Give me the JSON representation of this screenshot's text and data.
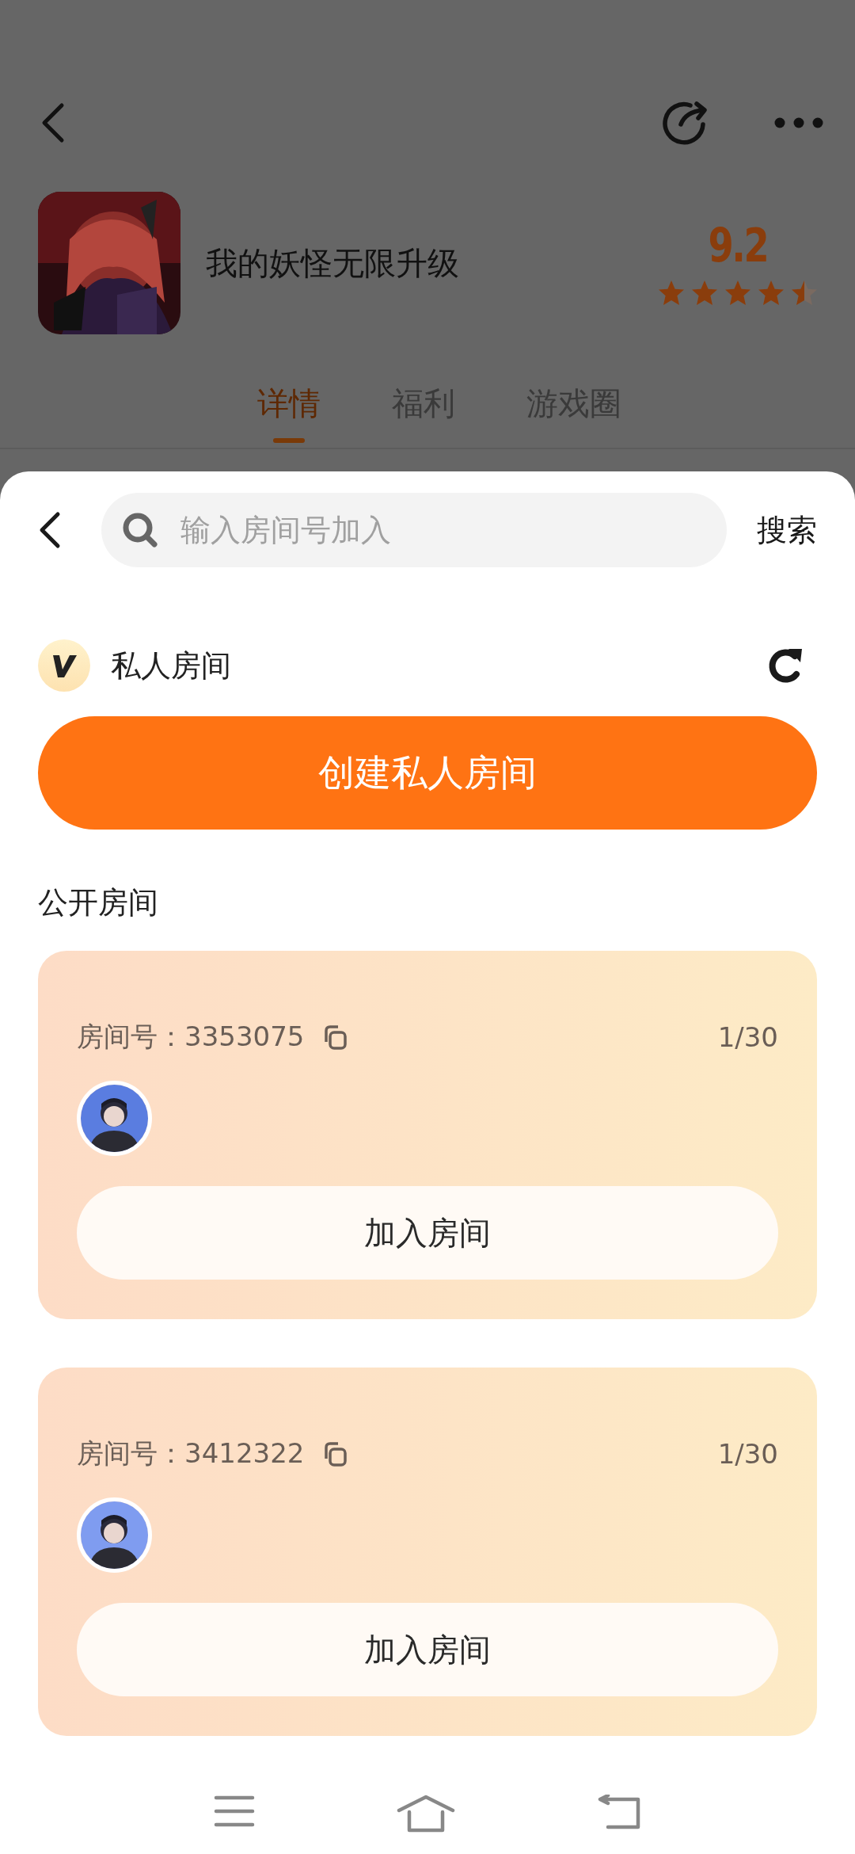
{
  "header": {
    "app_title": "我的妖怪无限升级",
    "score": "9.2",
    "stars": 4.5
  },
  "tabs": [
    {
      "label": "详情",
      "selected": true
    },
    {
      "label": "福利",
      "selected": false
    },
    {
      "label": "游戏圈",
      "selected": false
    }
  ],
  "sheet": {
    "search": {
      "placeholder": "输入房间号加入",
      "button": "搜索"
    },
    "private_room": {
      "title": "私人房间",
      "create_button": "创建私人房间"
    },
    "public_rooms": {
      "title": "公开房间",
      "rooms": [
        {
          "room_number": "房间号：3353075",
          "occupancy": "1/30",
          "join_button": "加入房间"
        },
        {
          "room_number": "房间号：3412322",
          "occupancy": "1/30",
          "join_button": "加入房间"
        }
      ]
    }
  }
}
